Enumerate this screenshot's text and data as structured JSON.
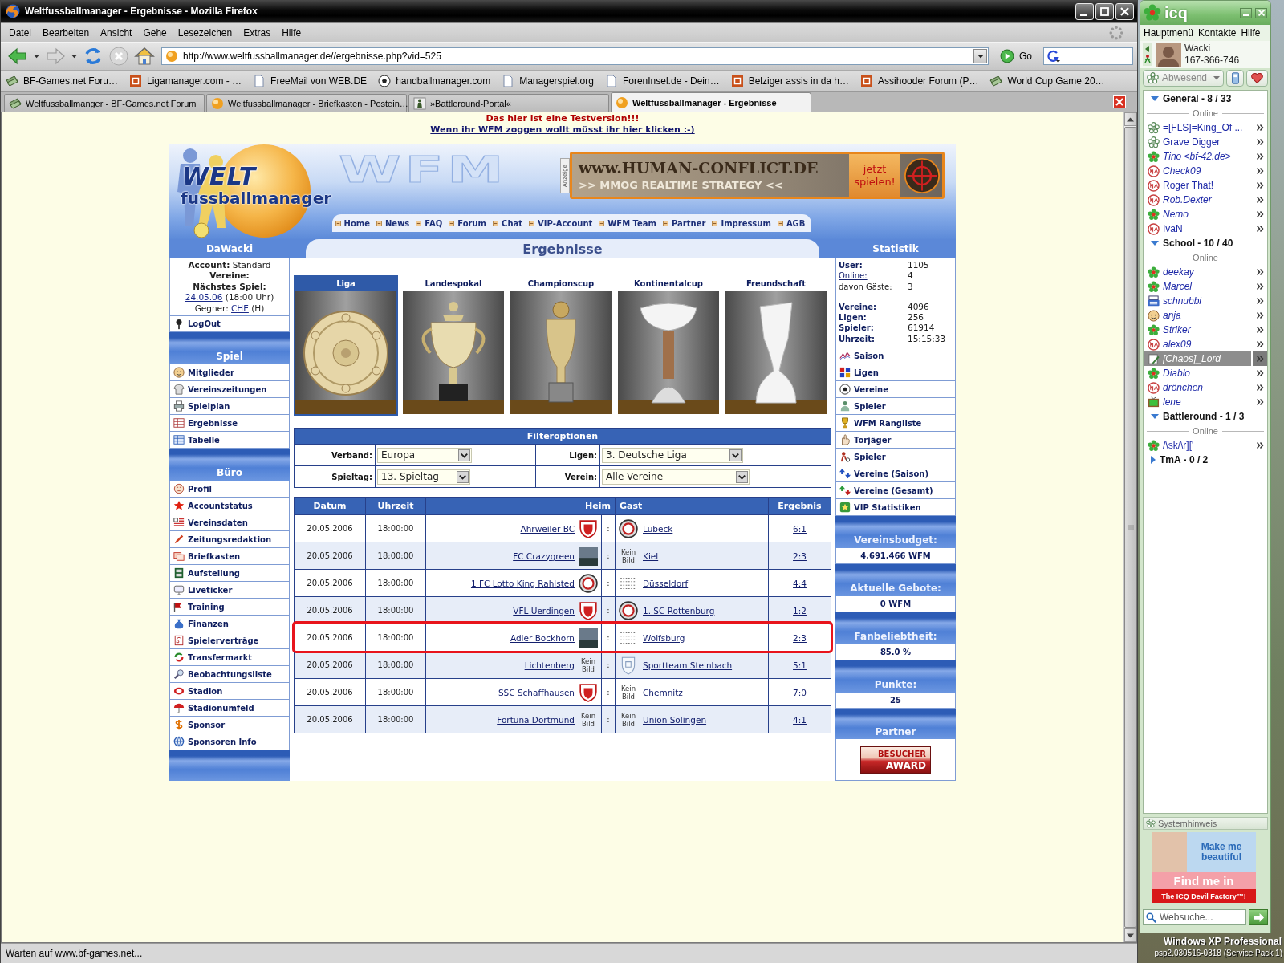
{
  "browser": {
    "title": "Weltfussballmanager - Ergebnisse - Mozilla Firefox",
    "menu": [
      "Datei",
      "Bearbeiten",
      "Ansicht",
      "Gehe",
      "Lesezeichen",
      "Extras",
      "Hilfe"
    ],
    "url": "http://www.weltfussballmanager.de//ergebnisse.php?vid=525",
    "go_label": "Go",
    "bookmarks": [
      {
        "label": "BF-Games.net Foru…",
        "kind": "money"
      },
      {
        "label": "Ligamanager.com - …",
        "kind": "square"
      },
      {
        "label": "FreeMail von WEB.DE",
        "kind": "page"
      },
      {
        "label": "handballmanager.com",
        "kind": "ball"
      },
      {
        "label": "Managerspiel.org",
        "kind": "page"
      },
      {
        "label": "ForenInsel.de - Dein…",
        "kind": "page"
      },
      {
        "label": "Belziger assis in da h…",
        "kind": "square"
      },
      {
        "label": "Assihooder Forum (P…",
        "kind": "square"
      },
      {
        "label": "World Cup Game 20…",
        "kind": "money"
      }
    ],
    "tabs": [
      {
        "label": "Weltfussballmanger - BF-Games.net Forum",
        "kind": "money",
        "selected": false
      },
      {
        "label": "Weltfussballmanager - Briefkasten - Postein…",
        "kind": "round",
        "selected": false
      },
      {
        "label": "»Battleround-Portal«",
        "kind": "soldier",
        "selected": false
      },
      {
        "label": "Weltfussballmanager - Ergebnisse",
        "kind": "round",
        "selected": true
      }
    ],
    "status_text": "Warten auf www.bf-games.net..."
  },
  "page": {
    "notice": "Das hier ist eine Testversion!!!",
    "notice_link": "Wenn ihr WFM zoggen wollt müsst ihr hier klicken :-)",
    "logo": {
      "line_1": "WELT",
      "line_2": "fussballmanager"
    },
    "watermark": "WFM",
    "ad": {
      "tag": "Anzeige",
      "headline": "www.HUMAN-CONFLICT.DE",
      "subline": ">> MMOG REALTIME STRATEGY <<",
      "cta": "jetzt spielen!"
    },
    "nav": [
      "Home",
      "News",
      "FAQ",
      "Forum",
      "Chat",
      "VIP-Account",
      "WFM Team",
      "Partner",
      "Impressum",
      "AGB"
    ],
    "title": "Ergebnisse",
    "user_panel": {
      "title": "DaWacki",
      "lines": [
        [
          {
            "text": "Account:",
            "kind": "label"
          },
          {
            "text": "Standard",
            "kind": "text"
          }
        ],
        [
          {
            "text": "Vereine:",
            "kind": "label"
          }
        ],
        [
          {
            "text": "Nächstes Spiel:",
            "kind": "label"
          }
        ],
        [
          {
            "text": "24.05.06",
            "kind": "link"
          },
          {
            "text": "(18:00 Uhr)",
            "kind": "text"
          }
        ],
        [
          {
            "text": "Gegner:",
            "kind": "text"
          },
          {
            "text": "CHE",
            "kind": "link"
          },
          {
            "text": "(H)",
            "kind": "text"
          }
        ]
      ]
    },
    "logout": {
      "label": "LogOut",
      "kind": "pin"
    },
    "menu_sections": [
      {
        "title": "Spiel",
        "items": [
          {
            "label": "Mitglieder",
            "kind": "face"
          },
          {
            "label": "Vereinszeitungen",
            "kind": "jersey"
          },
          {
            "label": "Spielplan",
            "kind": "printer"
          },
          {
            "label": "Ergebnisse",
            "kind": "grid"
          },
          {
            "label": "Tabelle",
            "kind": "table"
          }
        ]
      },
      {
        "title": "Büro",
        "items": [
          {
            "label": "Profil",
            "kind": "portrait"
          },
          {
            "label": "Accountstatus",
            "kind": "star"
          },
          {
            "label": "Vereinsdaten",
            "kind": "list"
          },
          {
            "label": "Zeitungsredaktion",
            "kind": "pen"
          },
          {
            "label": "Briefkasten",
            "kind": "mail"
          },
          {
            "label": "Aufstellung",
            "kind": "cabinet"
          },
          {
            "label": "Liveticker",
            "kind": "monitor"
          },
          {
            "label": "Training",
            "kind": "flag"
          },
          {
            "label": "Finanzen",
            "kind": "bag"
          },
          {
            "label": "Spielerverträge",
            "kind": "contract"
          },
          {
            "label": "Transfermarkt",
            "kind": "cycle"
          },
          {
            "label": "Beobachtungsliste",
            "kind": "magnifier"
          },
          {
            "label": "Stadion",
            "kind": "stadium"
          },
          {
            "label": "Stadionumfeld",
            "kind": "umbrella"
          },
          {
            "label": "Sponsor",
            "kind": "dollar"
          },
          {
            "label": "Sponsoren Info",
            "kind": "globe"
          }
        ]
      }
    ],
    "stats_panel": {
      "title": "Statistik",
      "groups": [
        [
          {
            "label": "User:",
            "value": "1105",
            "kind": "label"
          },
          {
            "label": "Online:",
            "value": "4",
            "kind": "link"
          },
          {
            "label": "davon Gäste:",
            "value": "3",
            "kind": "note"
          }
        ],
        [
          {
            "label": "Vereine:",
            "value": "4096",
            "kind": "label"
          },
          {
            "label": "Ligen:",
            "value": "256",
            "kind": "label"
          },
          {
            "label": "Spieler:",
            "value": "61914",
            "kind": "label"
          },
          {
            "label": "Uhrzeit:",
            "value": "15:15:33",
            "kind": "label"
          }
        ]
      ],
      "links": [
        {
          "label": "Saison",
          "kind": "chart"
        },
        {
          "label": "Ligen",
          "kind": "blocks"
        },
        {
          "label": "Vereine",
          "kind": "ball"
        },
        {
          "label": "Spieler",
          "kind": "person"
        },
        {
          "label": "WFM Rangliste",
          "kind": "trophy"
        },
        {
          "label": "Torjäger",
          "kind": "hand"
        },
        {
          "label": "Spieler",
          "kind": "player"
        },
        {
          "label": "Vereine (Saison)",
          "kind": "updown"
        },
        {
          "label": "Vereine (Gesamt)",
          "kind": "updownred"
        },
        {
          "label": "VIP Statistiken",
          "kind": "vip"
        }
      ],
      "boxes": [
        {
          "title": "Vereinsbudget:",
          "value": "4.691.466 WFM"
        },
        {
          "title": "Aktuelle Gebote:",
          "value": "0 WFM"
        },
        {
          "title": "Fanbeliebtheit:",
          "value": "85.0 %"
        },
        {
          "title": "Punkte:",
          "value": "25"
        }
      ],
      "partner": {
        "title": "Partner",
        "badge_line_1": "BESUCHER",
        "badge_line_2": "AWARD"
      }
    },
    "cups": [
      {
        "label": "Liga",
        "selected": true,
        "kind": "plate"
      },
      {
        "label": "Landespokal",
        "selected": false,
        "kind": "cup"
      },
      {
        "label": "Championscup",
        "selected": false,
        "kind": "goblet"
      },
      {
        "label": "Kontinentalcup",
        "selected": false,
        "kind": "chalice"
      },
      {
        "label": "Freundschaft",
        "selected": false,
        "kind": "vase"
      }
    ],
    "filter": {
      "title": "Filteroptionen",
      "fields": [
        {
          "label": "Verband:",
          "value": "Europa"
        },
        {
          "label": "Ligen:",
          "value": "3. Deutsche Liga"
        },
        {
          "label": "Spieltag:",
          "value": "13. Spieltag"
        },
        {
          "label": "Verein:",
          "value": "Alle Vereine"
        }
      ]
    },
    "results": {
      "columns": [
        "Datum",
        "Uhrzeit",
        "Heim",
        "Gast",
        "Ergebnis"
      ],
      "rows": [
        {
          "date": "20.05.2006",
          "time": "18:00:00",
          "home": "Ahrweiler BC",
          "home_logo": {
            "kind": "shield"
          },
          "separator": ":",
          "guest": "Lübeck",
          "guest_logo": {
            "kind": "roundel"
          },
          "result": "6:1",
          "highlighted": false
        },
        {
          "date": "20.05.2006",
          "time": "18:00:00",
          "home": "FC Crazygreen",
          "home_logo": {
            "kind": "photo"
          },
          "separator": ":",
          "guest": "Kiel",
          "guest_logo": {
            "kind": "none",
            "text": "Kein Bild"
          },
          "result": "2:3",
          "highlighted": false
        },
        {
          "date": "20.05.2006",
          "time": "18:00:00",
          "home": "1 FC Lotto King Rahlsted",
          "home_logo": {
            "kind": "roundel"
          },
          "separator": ":",
          "guest": "Düsseldorf",
          "guest_logo": {
            "kind": "pattern"
          },
          "result": "4:4",
          "highlighted": false
        },
        {
          "date": "20.05.2006",
          "time": "18:00:00",
          "home": "VFL Uerdingen",
          "home_logo": {
            "kind": "shield"
          },
          "separator": ":",
          "guest": "1. SC Rottenburg",
          "guest_logo": {
            "kind": "roundel"
          },
          "result": "1:2",
          "highlighted": false
        },
        {
          "date": "20.05.2006",
          "time": "18:00:00",
          "home": "Adler Bockhorn",
          "home_logo": {
            "kind": "photo"
          },
          "separator": ":",
          "guest": "Wolfsburg",
          "guest_logo": {
            "kind": "pattern"
          },
          "result": "2:3",
          "highlighted": true
        },
        {
          "date": "20.05.2006",
          "time": "18:00:00",
          "home": "Lichtenberg",
          "home_logo": {
            "kind": "none",
            "text": "Kein Bild"
          },
          "separator": ":",
          "guest": "Sportteam Steinbach",
          "guest_logo": {
            "kind": "outline"
          },
          "result": "5:1",
          "highlighted": false
        },
        {
          "date": "20.05.2006",
          "time": "18:00:00",
          "home": "SSC Schaffhausen",
          "home_logo": {
            "kind": "shield"
          },
          "separator": ":",
          "guest": "Chemnitz",
          "guest_logo": {
            "kind": "none",
            "text": "Kein Bild"
          },
          "result": "7:0",
          "highlighted": false
        },
        {
          "date": "20.05.2006",
          "time": "18:00:00",
          "home": "Fortuna Dortmund",
          "home_logo": {
            "kind": "none",
            "text": "Kein Bild"
          },
          "separator": ":",
          "guest": "Union Solingen",
          "guest_logo": {
            "kind": "none",
            "text": "Kein Bild"
          },
          "result": "4:1",
          "highlighted": false
        }
      ]
    }
  },
  "icq": {
    "title": "icq",
    "menu": [
      "Hauptmenü",
      "Kontakte",
      "Hilfe"
    ],
    "user": {
      "name": "Wacki",
      "uin": "167-366-746"
    },
    "status": "Abwesend",
    "groups": [
      {
        "label": "General - 8 / 33",
        "expanded": true,
        "divider": "Online",
        "contacts": [
          {
            "name": "=[FLS]=King_Of ...",
            "kind": "ring",
            "italic": false,
            "selected": false
          },
          {
            "name": "Grave Digger",
            "kind": "ring",
            "italic": false,
            "selected": false
          },
          {
            "name": "Tino <bf-42.de>",
            "kind": "flower",
            "italic": true,
            "selected": false
          },
          {
            "name": "Check09",
            "kind": "na",
            "italic": true,
            "selected": false
          },
          {
            "name": "Roger That!",
            "kind": "na",
            "italic": false,
            "selected": false
          },
          {
            "name": "Rob.Dexter",
            "kind": "na",
            "italic": true,
            "selected": false
          },
          {
            "name": "Nemo",
            "kind": "flower",
            "italic": true,
            "selected": false
          },
          {
            "name": "IvaN",
            "kind": "na",
            "italic": false,
            "selected": false
          }
        ]
      },
      {
        "label": "School - 10 / 40",
        "expanded": true,
        "divider": "Online",
        "contacts": [
          {
            "name": "deekay",
            "kind": "flower",
            "italic": true,
            "selected": false
          },
          {
            "name": "Marcel",
            "kind": "flower",
            "italic": true,
            "selected": false
          },
          {
            "name": "schnubbi",
            "kind": "typewriter",
            "italic": true,
            "selected": false
          },
          {
            "name": "anja",
            "kind": "face",
            "italic": true,
            "selected": false
          },
          {
            "name": "Striker",
            "kind": "flower",
            "italic": true,
            "selected": false
          },
          {
            "name": "alex09",
            "kind": "na",
            "italic": true,
            "selected": false
          },
          {
            "name": "[Chaos]_Lord",
            "kind": "note",
            "italic": true,
            "selected": true
          },
          {
            "name": "Diablo",
            "kind": "flower",
            "italic": true,
            "selected": false
          },
          {
            "name": "drönchen",
            "kind": "na",
            "italic": true,
            "selected": false
          },
          {
            "name": "lene",
            "kind": "tv",
            "italic": true,
            "selected": false
          }
        ]
      },
      {
        "label": "Battleround - 1 / 3",
        "expanded": true,
        "divider": "Online",
        "contacts": [
          {
            "name": "/\\sk/\\r]['",
            "kind": "flower",
            "italic": false,
            "selected": false
          }
        ]
      },
      {
        "label": "TmA - 0 / 2",
        "expanded": false
      }
    ],
    "notice_title": "Systemhinweis",
    "ad": {
      "line_1": "Make me beautiful",
      "line_2": "Find me in",
      "line_3": "The ICQ Devil Factory™!"
    },
    "search_placeholder": "Websuche..."
  },
  "desktop": {
    "line_1": "Windows XP Professional",
    "line_2": "psp2.030516-0318 (Service Pack 1)"
  }
}
